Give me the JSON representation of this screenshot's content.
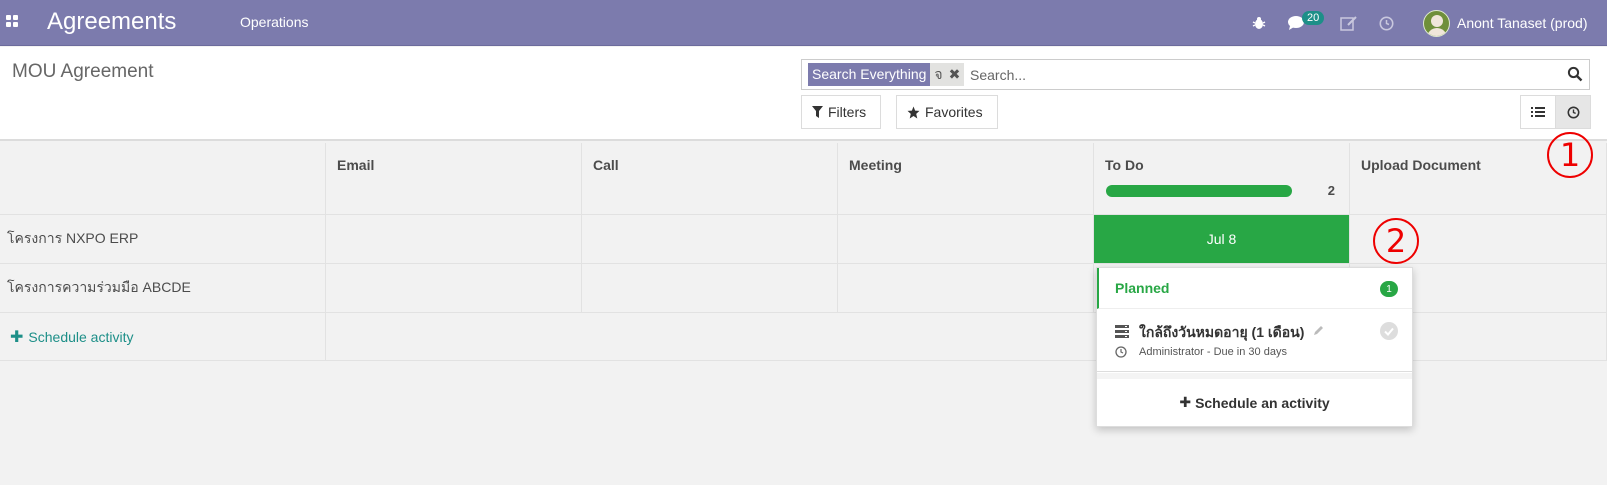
{
  "navbar": {
    "app_title": "Agreements",
    "menu_items": [
      "Operations"
    ],
    "messages_count": "20",
    "user_name": "Anont Tanaset (prod)"
  },
  "control_panel": {
    "breadcrumb": "MOU Agreement",
    "search": {
      "facet_label": "Search Everything",
      "facet_value": "จ",
      "placeholder": "Search..."
    },
    "filters_label": "Filters",
    "favorites_label": "Favorites"
  },
  "grid": {
    "columns": [
      "Email",
      "Call",
      "Meeting",
      "To Do",
      "Upload Document"
    ],
    "todo_count": "2",
    "todo_progress_percent": 100,
    "rows": [
      {
        "label": "โครงการ NXPO ERP",
        "due_date": "Jul 8"
      },
      {
        "label": "โครงการความร่วมมือ ABCDE"
      }
    ],
    "schedule_label": "Schedule activity"
  },
  "popover": {
    "group_label": "Planned",
    "group_count": "1",
    "activity_title": "ใกล้ถึงวันหมดอายุ (1 เดือน)",
    "activity_sub": "Administrator - Due in 30 days",
    "footer_label": "Schedule an activity"
  },
  "annotations": [
    "1",
    "2"
  ],
  "colors": {
    "navbar": "#7c7bad",
    "success": "#28a745",
    "link": "#1d8f88",
    "annotation": "#e00000"
  }
}
